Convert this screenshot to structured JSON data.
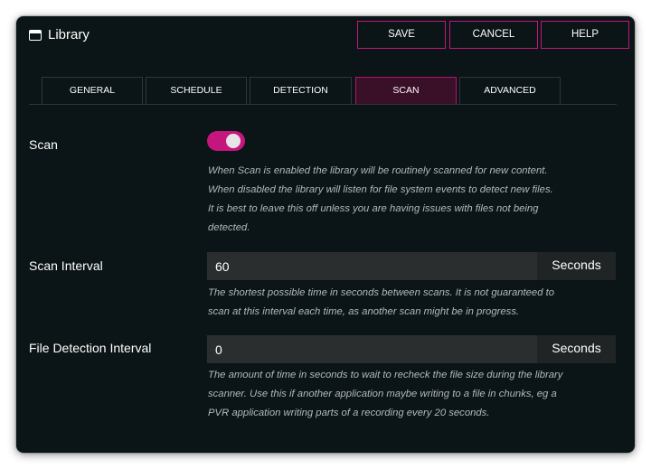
{
  "dialog": {
    "title": "Library",
    "title_icon": "window-icon"
  },
  "actions": {
    "save": "SAVE",
    "cancel": "CANCEL",
    "help": "HELP",
    "accent_color": "#c5167e"
  },
  "tabs": [
    {
      "label": "GENERAL",
      "active": false
    },
    {
      "label": "SCHEDULE",
      "active": false
    },
    {
      "label": "DETECTION",
      "active": false
    },
    {
      "label": "SCAN",
      "active": true
    },
    {
      "label": "ADVANCED",
      "active": false
    }
  ],
  "settings": {
    "scan": {
      "label": "Scan",
      "enabled": true,
      "help": [
        "When Scan is enabled the library will be routinely scanned for new content.",
        "When disabled the library will listen for file system events to detect new files.",
        "It is best to leave this off unless you are having issues with files not being",
        "detected."
      ]
    },
    "scan_interval": {
      "label": "Scan Interval",
      "value": "60",
      "unit": "Seconds",
      "help": [
        "The shortest possible time in seconds between scans.  It is not guaranteed to",
        "scan at this interval each time, as another scan might be in progress."
      ]
    },
    "file_detection_interval": {
      "label": "File Detection Interval",
      "value": "0",
      "unit": "Seconds",
      "help": [
        "The amount of time in seconds to wait to recheck the file size during the library",
        "scanner.  Use this if another application maybe writing to a file in chunks, eg a",
        "PVR application writing parts of a recording every 20 seconds."
      ]
    }
  }
}
